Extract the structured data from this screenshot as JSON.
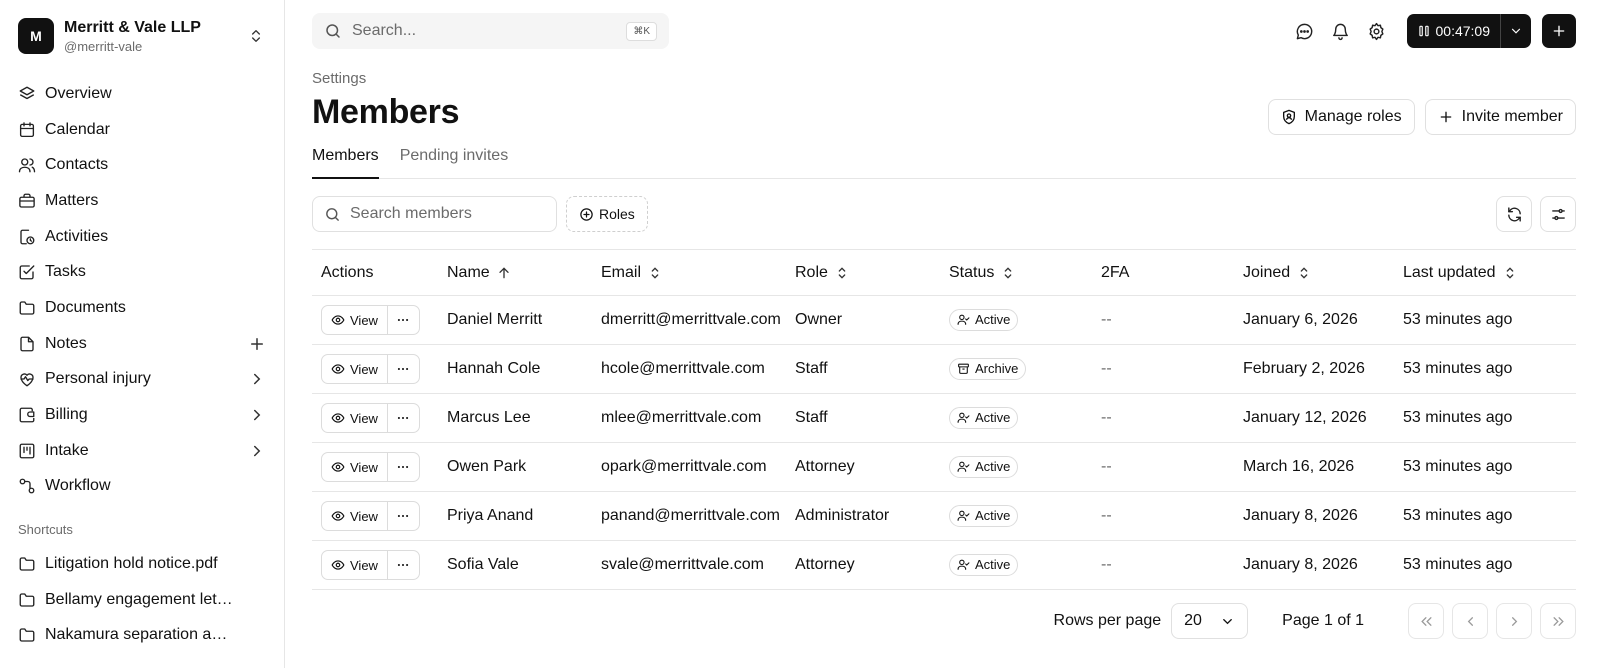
{
  "org": {
    "initial": "M",
    "name": "Merritt & Vale LLP",
    "handle": "@merritt-vale"
  },
  "nav": [
    {
      "label": "Overview",
      "icon": "layers-icon"
    },
    {
      "label": "Calendar",
      "icon": "calendar-icon"
    },
    {
      "label": "Contacts",
      "icon": "users-icon"
    },
    {
      "label": "Matters",
      "icon": "briefcase-icon"
    },
    {
      "label": "Activities",
      "icon": "activity-clock-icon"
    },
    {
      "label": "Tasks",
      "icon": "checkbox-icon"
    },
    {
      "label": "Documents",
      "icon": "folder-icon"
    },
    {
      "label": "Notes",
      "icon": "note-icon"
    },
    {
      "label": "Personal injury",
      "icon": "heart-pulse-icon"
    },
    {
      "label": "Billing",
      "icon": "wallet-icon"
    },
    {
      "label": "Intake",
      "icon": "kanban-icon"
    },
    {
      "label": "Workflow",
      "icon": "workflow-icon"
    }
  ],
  "shortcuts": {
    "label": "Shortcuts",
    "items": [
      {
        "label": "Litigation hold notice.pdf"
      },
      {
        "label": "Bellamy engagement letter"
      },
      {
        "label": "Nakamura separation agreement"
      }
    ]
  },
  "topbar": {
    "search_placeholder": "Search...",
    "shortcut": "⌘K",
    "timer": "00:47:09"
  },
  "breadcrumb": "Settings",
  "page_title": "Members",
  "actions": {
    "manage_roles": "Manage roles",
    "invite_member": "Invite member"
  },
  "tabs": [
    {
      "label": "Members",
      "active": true
    },
    {
      "label": "Pending invites",
      "active": false
    }
  ],
  "filters": {
    "search_placeholder": "Search members",
    "roles_label": "Roles"
  },
  "table": {
    "columns": [
      "Actions",
      "Name",
      "Email",
      "Role",
      "Status",
      "2FA",
      "Joined",
      "Last updated"
    ],
    "view_label": "View",
    "rows": [
      {
        "name": "Daniel Merritt",
        "email": "dmerritt@merrittvale.com",
        "role": "Owner",
        "status": "Active",
        "twofa": "--",
        "joined": "January 6, 2026",
        "updated": "53 minutes ago"
      },
      {
        "name": "Hannah Cole",
        "email": "hcole@merrittvale.com",
        "role": "Staff",
        "status": "Archive",
        "twofa": "--",
        "joined": "February 2, 2026",
        "updated": "53 minutes ago"
      },
      {
        "name": "Marcus Lee",
        "email": "mlee@merrittvale.com",
        "role": "Staff",
        "status": "Active",
        "twofa": "--",
        "joined": "January 12, 2026",
        "updated": "53 minutes ago"
      },
      {
        "name": "Owen Park",
        "email": "opark@merrittvale.com",
        "role": "Attorney",
        "status": "Active",
        "twofa": "--",
        "joined": "March 16, 2026",
        "updated": "53 minutes ago"
      },
      {
        "name": "Priya Anand",
        "email": "panand@merrittvale.com",
        "role": "Administrator",
        "status": "Active",
        "twofa": "--",
        "joined": "January 8, 2026",
        "updated": "53 minutes ago"
      },
      {
        "name": "Sofia Vale",
        "email": "svale@merrittvale.com",
        "role": "Attorney",
        "status": "Active",
        "twofa": "--",
        "joined": "January 8, 2026",
        "updated": "53 minutes ago"
      }
    ]
  },
  "pagination": {
    "rows_per_page_label": "Rows per page",
    "rows_per_page": "20",
    "page_info": "Page 1 of 1"
  }
}
